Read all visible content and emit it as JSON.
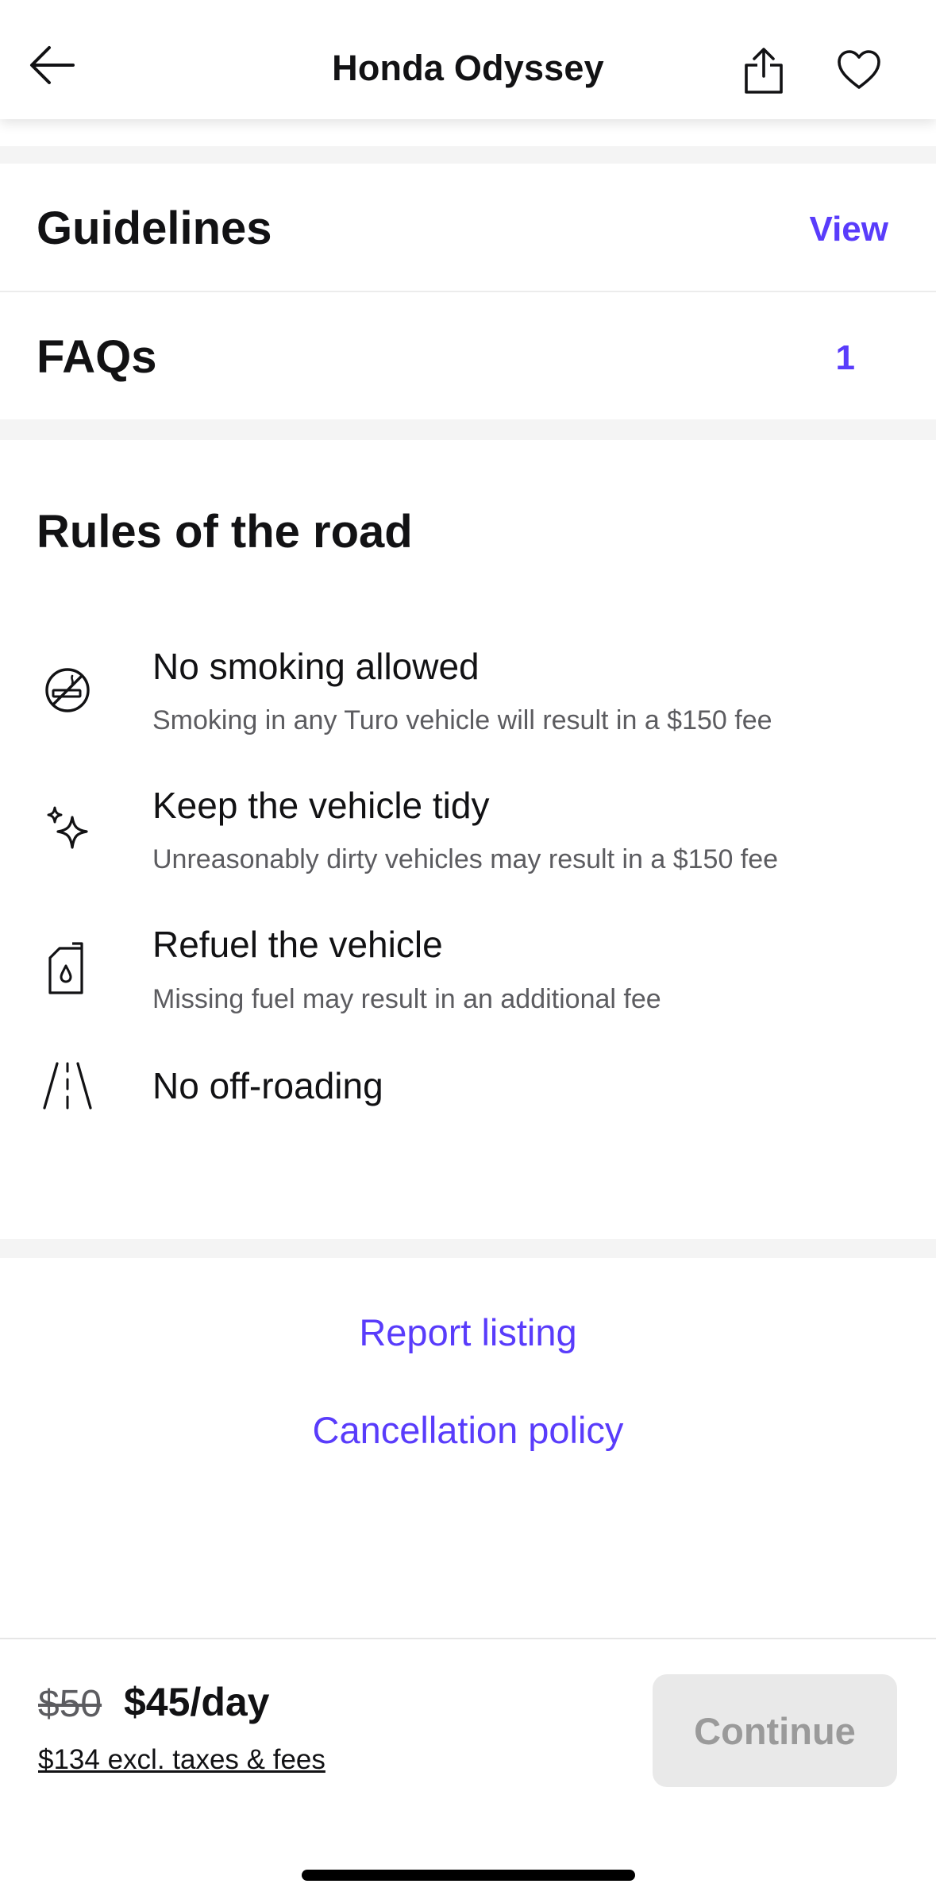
{
  "header": {
    "title": "Honda Odyssey"
  },
  "guidelines": {
    "title": "Guidelines",
    "action": "View"
  },
  "faqs": {
    "title": "FAQs",
    "count": "1"
  },
  "rules": {
    "heading": "Rules of the road",
    "items": [
      {
        "icon": "no-smoking-icon",
        "title": "No smoking allowed",
        "description": "Smoking in any Turo vehicle will result in a $150 fee"
      },
      {
        "icon": "sparkle-icon",
        "title": "Keep the vehicle tidy",
        "description": "Unreasonably dirty vehicles may result in a $150 fee"
      },
      {
        "icon": "fuel-can-icon",
        "title": "Refuel the vehicle",
        "description": "Missing fuel may result in an additional fee"
      },
      {
        "icon": "road-icon",
        "title": "No off-roading",
        "description": ""
      }
    ]
  },
  "footer": {
    "report_label": "Report listing",
    "cancellation_label": "Cancellation policy"
  },
  "booking": {
    "old_price": "$50",
    "new_price": "$45/day",
    "total": "$134 excl. taxes & fees",
    "continue_label": "Continue"
  },
  "colors": {
    "accent": "#593cfb",
    "disabled_button_bg": "#e9e9e9",
    "disabled_button_text": "#9a9a9a",
    "band_gray": "#f4f4f4"
  }
}
